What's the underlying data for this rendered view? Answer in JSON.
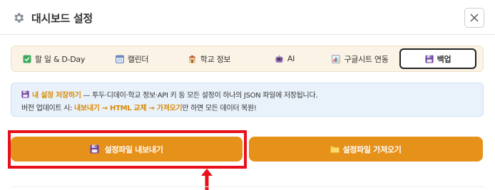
{
  "dialog": {
    "title": "대시보드 설정",
    "icon": "gear-icon"
  },
  "tabs": [
    {
      "label": "할 일 & D-Day",
      "icon": "check-square-icon",
      "active": false
    },
    {
      "label": "캘린더",
      "icon": "calendar-icon",
      "active": false
    },
    {
      "label": "학교 정보",
      "icon": "school-icon",
      "active": false
    },
    {
      "label": "AI",
      "icon": "robot-icon",
      "active": false
    },
    {
      "label": "구글시트 연동",
      "icon": "bar-chart-icon",
      "active": false
    },
    {
      "label": "백업",
      "icon": "floppy-disk-icon",
      "active": true
    }
  ],
  "info": {
    "line1_highlight": "내 설정 저장하기",
    "line1_rest": " — 투두·디데이·학교 정보·API 키 등 모든 설정이 하나의 JSON 파일에 저장됩니다.",
    "line2_prefix": "버전 업데이트 시: ",
    "line2_highlight": "내보내기 → HTML 교체 → 가져오기",
    "line2_suffix": "만 하면 모든 데이터 복원!"
  },
  "buttons": {
    "export_label": "설정파일 내보내기",
    "import_label": "설정파일 가져오기"
  },
  "colors": {
    "accent": "#e6911a",
    "highlight_text": "#d98b06",
    "annotation_red": "#e8101a",
    "info_bg": "#e9f2fb",
    "tabs_bg": "#fbf4e6"
  }
}
